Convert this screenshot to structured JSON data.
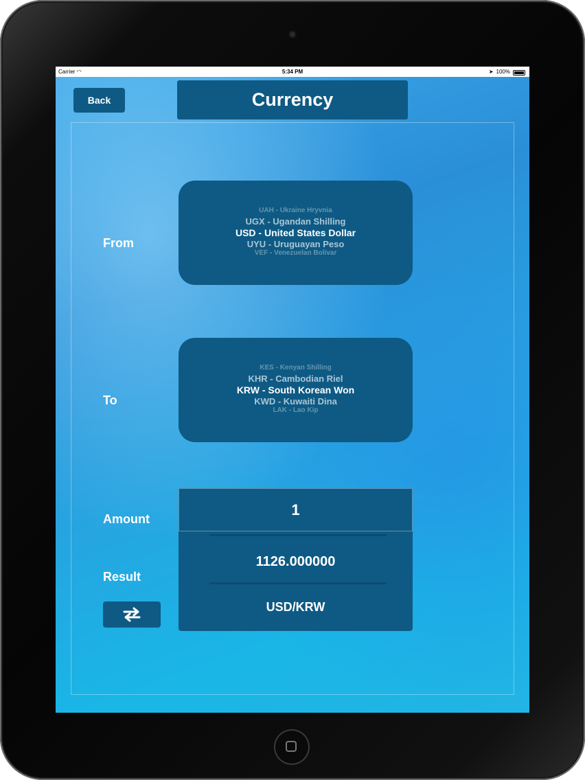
{
  "status": {
    "carrier": "Carrier",
    "time": "5:34 PM",
    "battery": "100%"
  },
  "header": {
    "back_label": "Back",
    "title": "Currency"
  },
  "form": {
    "from_label": "From",
    "to_label": "To",
    "amount_label": "Amount",
    "result_label": "Result"
  },
  "from_picker": {
    "options": [
      "UAH - Ukraine Hryvnia",
      "UGX - Ugandan Shilling",
      "USD - United States Dollar",
      "UYU - Uruguayan Peso",
      "VEF - Venezuelan Bolivar"
    ],
    "selected": "USD - United States Dollar"
  },
  "to_picker": {
    "options": [
      "KES - Kenyan Shilling",
      "KHR - Cambodian Riel",
      "KRW - South Korean Won",
      "KWD - Kuwaiti Dina",
      "LAK - Lao Kip"
    ],
    "selected": "KRW - South Korean Won"
  },
  "amount": {
    "value": "1"
  },
  "result": {
    "value": "1126.000000",
    "pair": "USD/KRW"
  },
  "swap_button": {
    "icon": "swap-arrows-icon"
  },
  "colors": {
    "panel": "#0e5a84",
    "background": "#2a8fd8",
    "text": "#ffffff"
  }
}
